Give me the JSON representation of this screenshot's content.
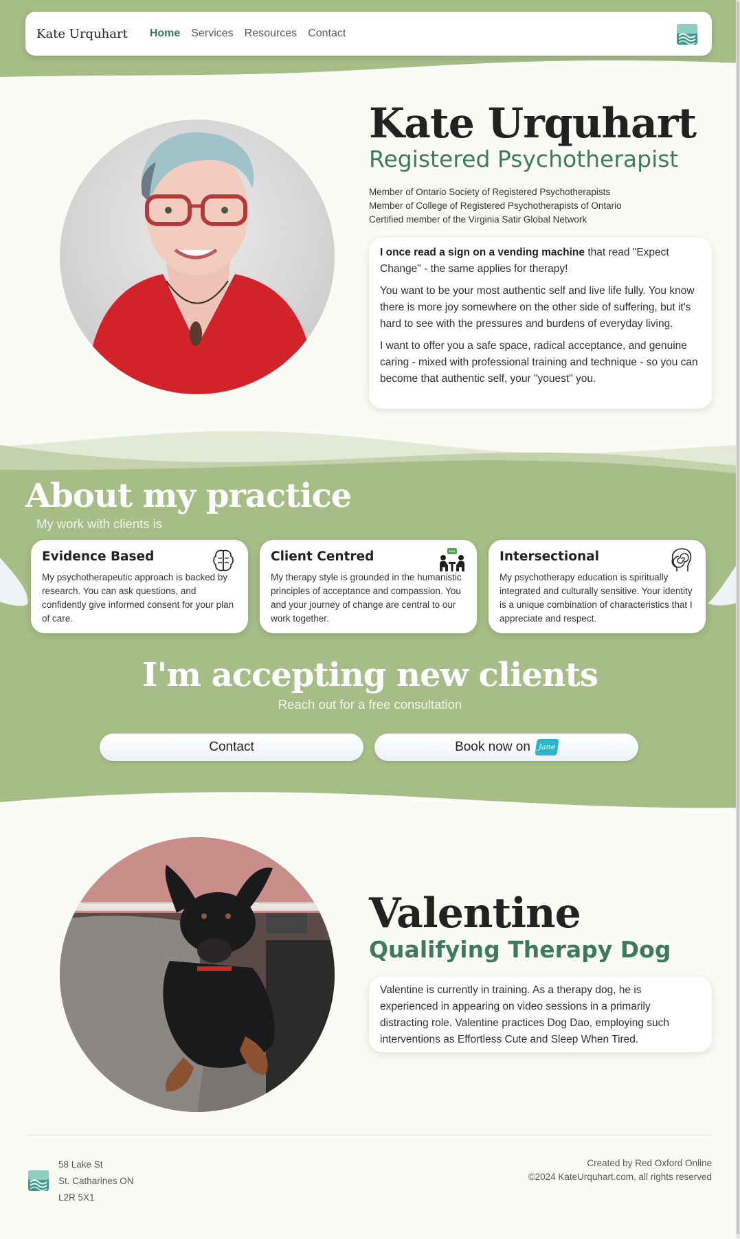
{
  "colors": {
    "sage_green": "#a6bd87",
    "light_sage": "#c3d2ab",
    "pale_sage": "#e2e9d5",
    "accent_green": "#3e7b5e",
    "page_bg": "#fbfbf6"
  },
  "nav": {
    "brand": "Kate Urquhart",
    "links": [
      {
        "label": "Home",
        "active": true
      },
      {
        "label": "Services"
      },
      {
        "label": "Resources"
      },
      {
        "label": "Contact"
      }
    ],
    "logo_icon": "wave-logo-icon"
  },
  "hero": {
    "photo_icon": "portrait-photo",
    "name": "Kate Urquhart",
    "title": "Registered Psychotherapist",
    "memberships": [
      "Member of Ontario Society of Registered Psychotherapists",
      "Member of College of Registered Psychotherapists of Ontario",
      "Certified member of the Virginia Satir Global Network"
    ],
    "quote": {
      "lead_bold": "I once read a sign on a vending machine",
      "lead_rest": " that read \"Expect Change\" - the same applies for therapy!",
      "para2": "You want to be your most authentic self and live life fully. You know there is more joy somewhere on the other side of suffering, but it's hard to see with the pressures and burdens of everyday living.",
      "para3": "I want to offer you a safe space, radical acceptance, and genuine caring - mixed with professional training and technique - so you can become that authentic self, your \"youest\" you."
    }
  },
  "about": {
    "title": "About my practice",
    "subtitle": "My work with clients is",
    "features": [
      {
        "title": "Evidence Based",
        "icon": "brain-icon",
        "text": "My psychotherapeutic approach is backed by research. You can ask questions, and confidently give informed consent for your plan of care."
      },
      {
        "title": "Client Centred",
        "icon": "conversation-icon",
        "text": "My therapy style is grounded in the humanistic principles of acceptance and compassion. You and your journey of change are central to our work together."
      },
      {
        "title": "Intersectional",
        "icon": "head-spiral-icon",
        "text": "My psychotherapy education is spiritually integrated and culturally sensitive. Your identity is a unique combination of characteristics that I appreciate and respect."
      }
    ]
  },
  "accepting": {
    "title": "I'm accepting new clients",
    "subtitle": "Reach out for a free consultation",
    "contact_button": "Contact",
    "book_button": "Book now on",
    "book_badge": "Jane"
  },
  "dog": {
    "photo_icon": "dog-photo",
    "name": "Valentine",
    "title": "Qualifying Therapy Dog",
    "text": "Valentine is currently in training. As a therapy dog, he is experienced in appearing on video sessions in a primarily distracting role. Valentine practices Dog Dao, employing such interventions as Effortless Cute and Sleep When Tired."
  },
  "footer": {
    "logo_icon": "wave-logo-icon",
    "address": [
      "58 Lake St",
      "St. Catharines ON",
      "L2R 5X1"
    ],
    "credit": "Created by Red Oxford Online",
    "copyright": "©2024 KateUrquhart.com, all rights reserved"
  }
}
